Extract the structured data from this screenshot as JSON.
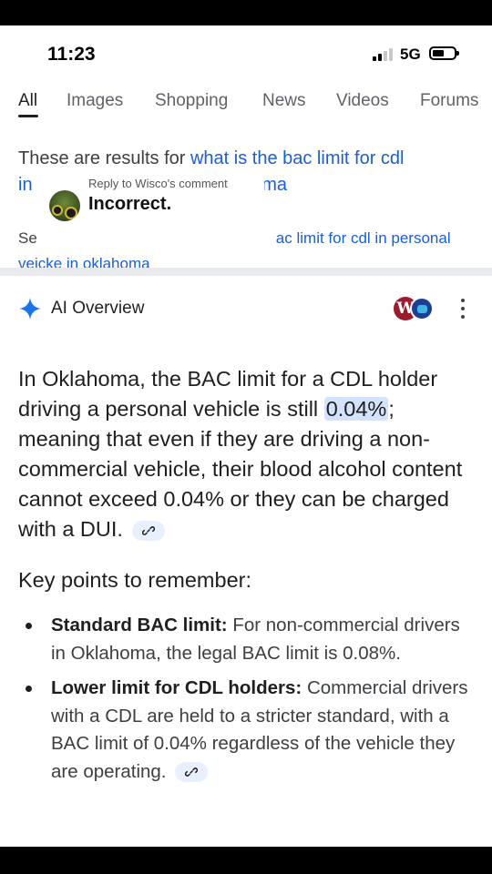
{
  "status_bar": {
    "time": "11:23",
    "network": "5G",
    "signal_bars_active": 2,
    "signal_bars_total": 4
  },
  "tabs": [
    {
      "label": "All",
      "active": true
    },
    {
      "label": "Images",
      "active": false
    },
    {
      "label": "Shopping",
      "active": false
    },
    {
      "label": "News",
      "active": false
    },
    {
      "label": "Videos",
      "active": false
    },
    {
      "label": "Forums",
      "active": false
    }
  ],
  "results_for": {
    "prefix": "These are results for ",
    "query_link": "what is the bac limit for cdl in personal vehicle in oklahoma",
    "query_link_visible_part1": "what is the bac limit for cdl",
    "query_link_visible_part2": "in",
    "query_link_visible_part3": "oma"
  },
  "search_instead": {
    "prefix_visible": "Se",
    "link_visible_part1": "ac limit for cdl in personal",
    "link_visible_part2": "ve​icke in oklahoma"
  },
  "reply_overlay": {
    "meta": "Reply to Wisco's comment",
    "text": "Incorrect."
  },
  "ai_overview": {
    "title": "AI Overview",
    "source_icon": "wisconsin-source-logo",
    "menu_icon": "more-vert-icon",
    "accent_color": "#1a73e8",
    "highlight_color": "#d3e3fd",
    "body_part1": "In Oklahoma, the BAC limit for a CDL holder driving a personal vehicle is still ",
    "body_highlight": "0.04%",
    "body_part2": "; meaning that even if they are driving a non-commercial vehicle, their blood alcohol content cannot exceed 0.04% or they can be charged with a DUI.",
    "key_points_title": "Key points to remember:",
    "key_points": [
      {
        "heading": "Standard BAC limit:",
        "text": " For non-commercial drivers in Oklahoma, the legal BAC limit is 0.08%."
      },
      {
        "heading": "Lower limit for CDL holders:",
        "text": " Commercial drivers with a CDL are held to a stricter standard, with a BAC limit of 0.04% regardless of the vehicle they are operating."
      }
    ]
  }
}
